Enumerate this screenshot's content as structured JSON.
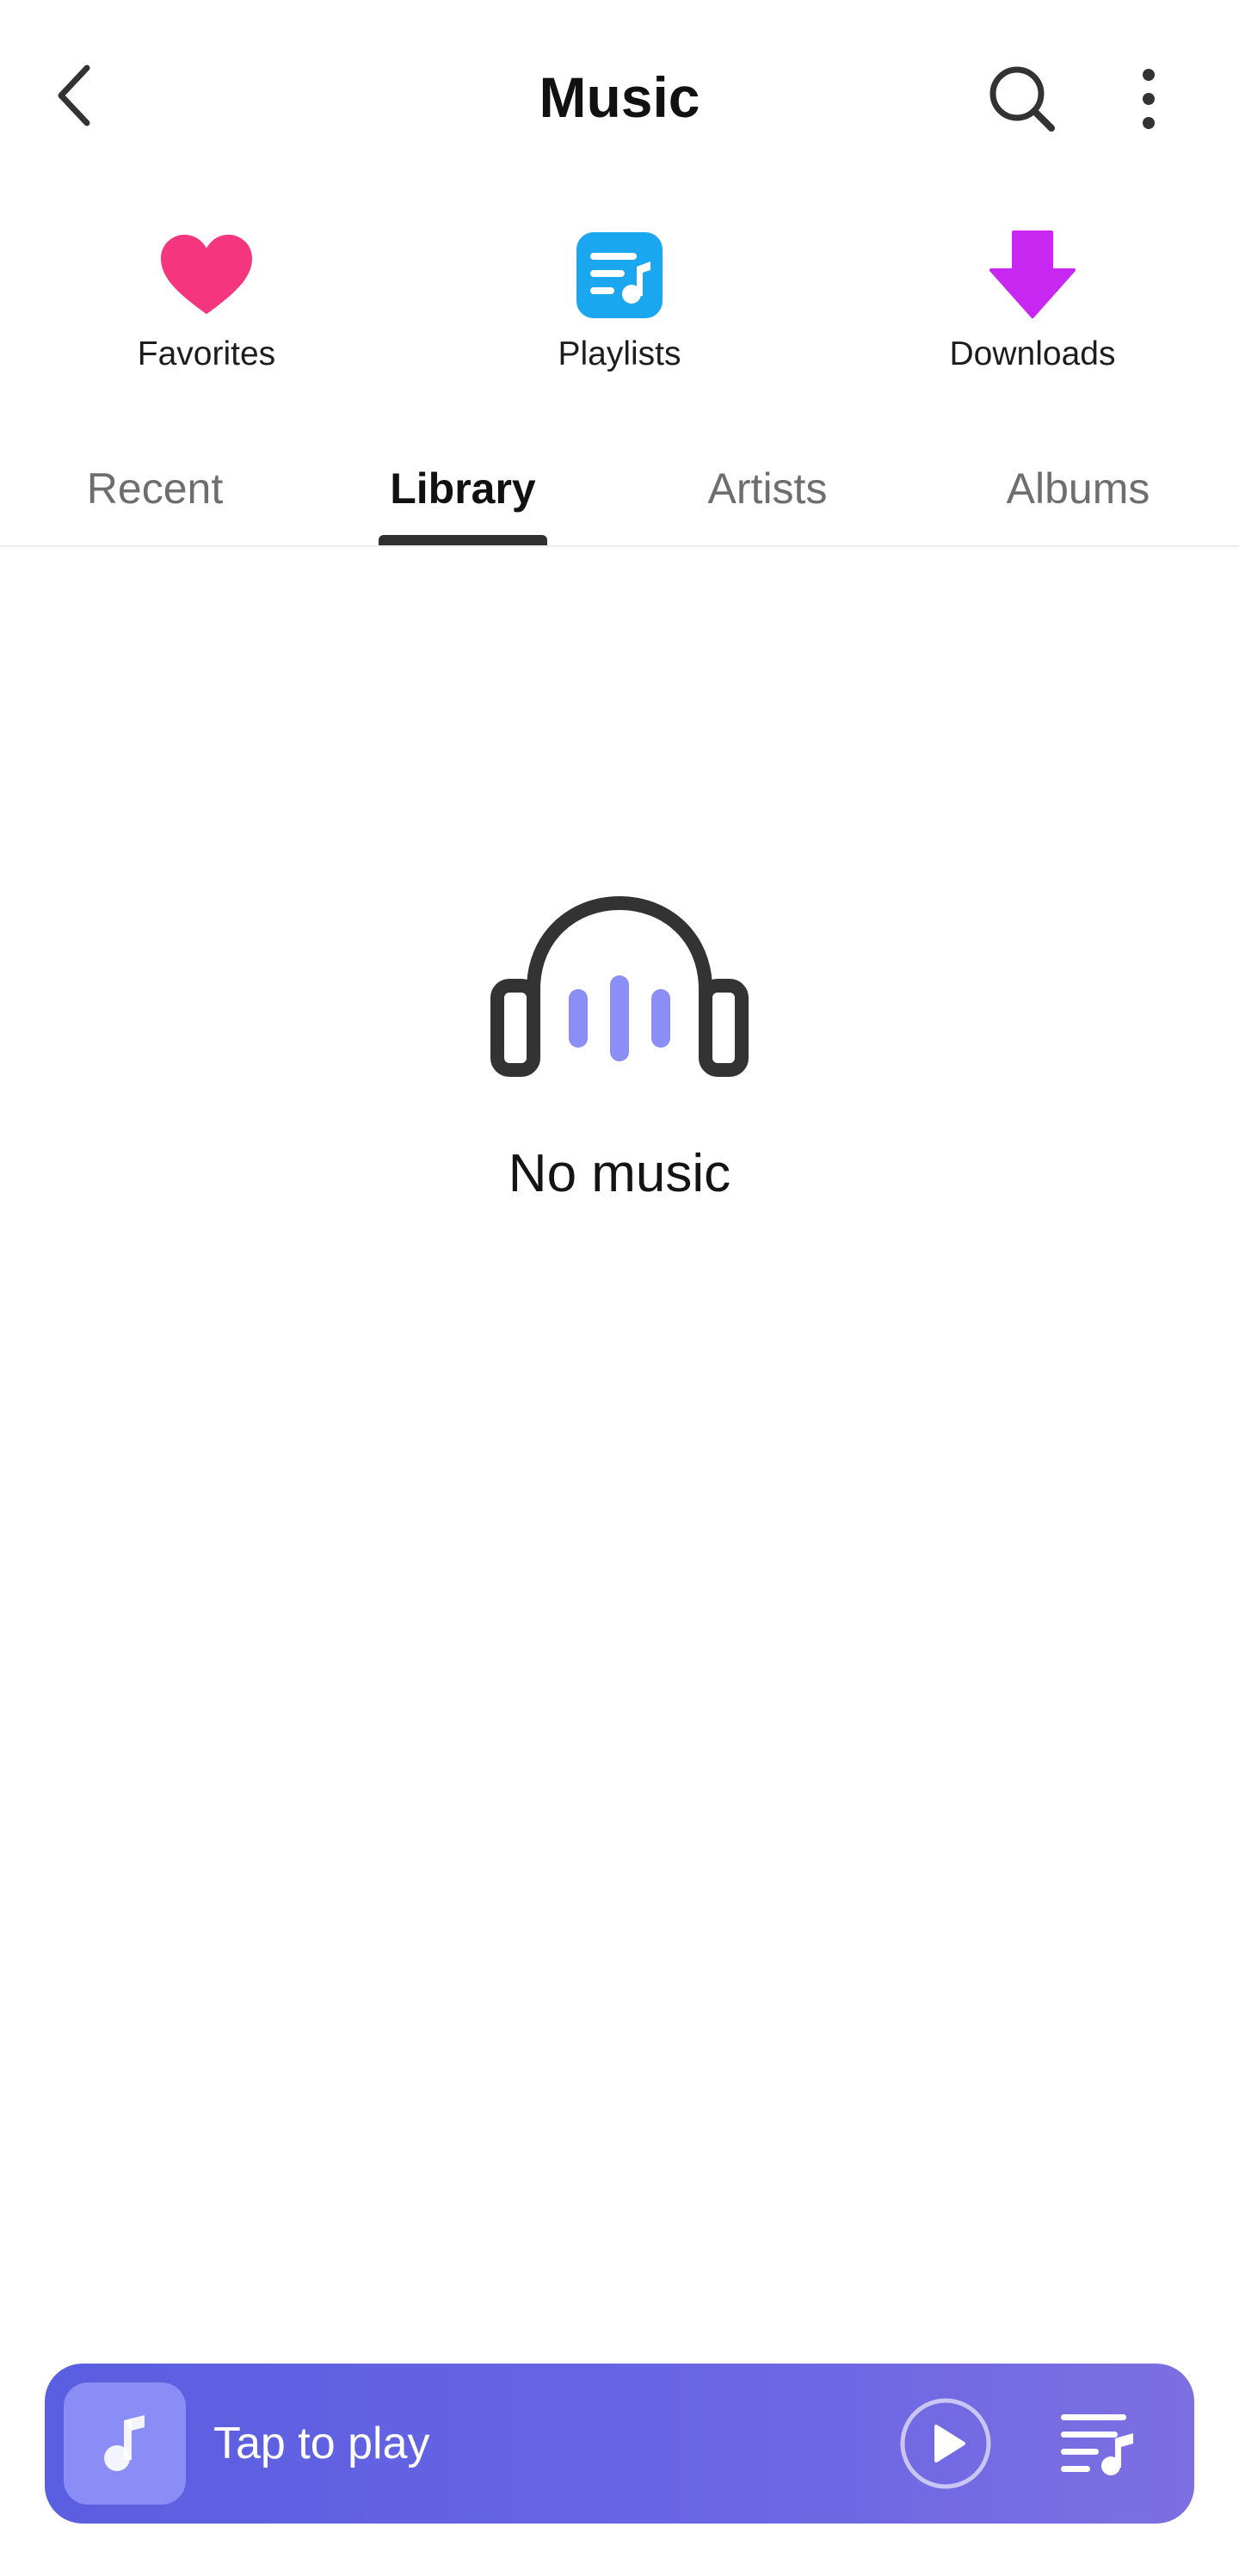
{
  "header": {
    "title": "Music",
    "back_icon": "back-arrow-icon",
    "search_icon": "search-icon",
    "more_icon": "more-vertical-icon"
  },
  "quick_access": [
    {
      "label": "Favorites",
      "icon": "heart-icon",
      "color": "#f5367f"
    },
    {
      "label": "Playlists",
      "icon": "playlist-icon",
      "color": "#1aa7f0"
    },
    {
      "label": "Downloads",
      "icon": "download-icon",
      "color": "#c727f1"
    }
  ],
  "tabs": [
    {
      "label": "Recent",
      "active": false
    },
    {
      "label": "Library",
      "active": true
    },
    {
      "label": "Artists",
      "active": false
    },
    {
      "label": "Albums",
      "active": false
    }
  ],
  "empty_state": {
    "icon": "headphones-icon",
    "message": "No music",
    "accent_color": "#8a8ef5"
  },
  "player": {
    "title": "Tap to play",
    "art_icon": "music-note-icon",
    "play_icon": "play-icon",
    "queue_icon": "queue-icon",
    "gradient_start": "#5a5ee0",
    "gradient_end": "#7d6fe2"
  }
}
